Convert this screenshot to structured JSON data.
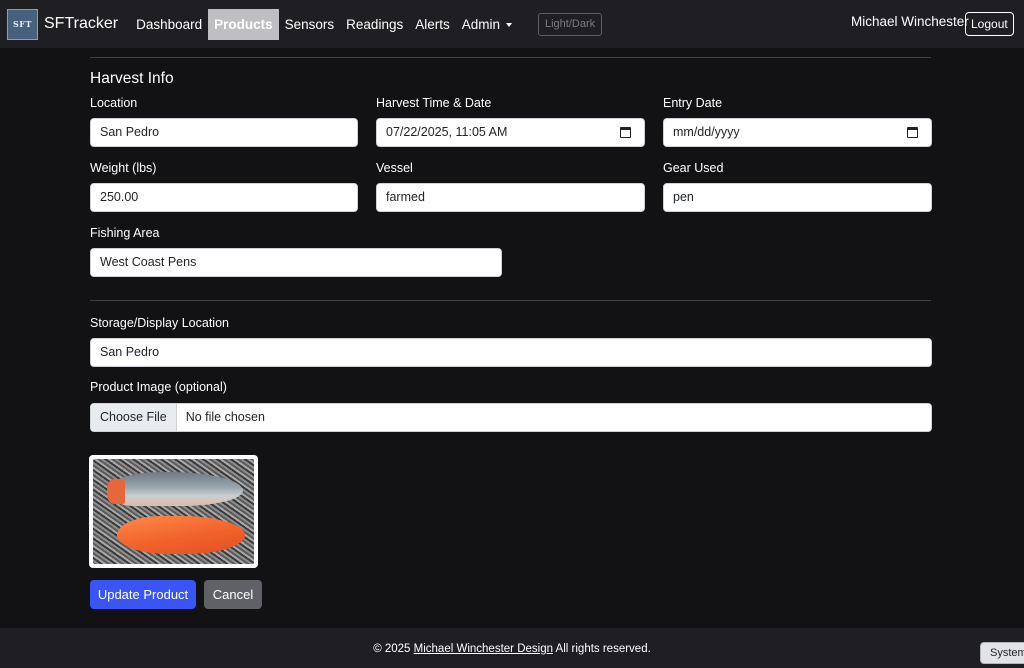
{
  "nav": {
    "logo_text": "SFT",
    "brand": "SFTracker",
    "links": [
      "Dashboard",
      "Products",
      "Sensors",
      "Readings",
      "Alerts",
      "Admin"
    ],
    "active": "Products",
    "theme_toggle": "Light/Dark",
    "user": "Michael Winchester",
    "logout": "Logout"
  },
  "harvest": {
    "title": "Harvest Info",
    "location": {
      "label": "Location",
      "value": "San Pedro"
    },
    "harvest_time": {
      "label": "Harvest Time & Date",
      "value": "07/22/2025, 11:05  AM"
    },
    "entry_date": {
      "label": "Entry Date",
      "value": "mm/dd/yyyy"
    },
    "weight": {
      "label": "Weight (lbs)",
      "value": "250.00"
    },
    "vessel": {
      "label": "Vessel",
      "value": "farmed"
    },
    "gear": {
      "label": "Gear Used",
      "value": "pen"
    },
    "fishing_area": {
      "label": "Fishing Area",
      "value": "West Coast Pens"
    }
  },
  "storage": {
    "label": "Storage/Display Location",
    "value": "San Pedro"
  },
  "image": {
    "label": "Product Image (optional)",
    "choose_button": "Choose File",
    "status": "No file chosen",
    "preview_icon": "salmon-fillet-photo"
  },
  "actions": {
    "update": "Update Product",
    "cancel": "Cancel"
  },
  "footer": {
    "prefix": "© 2025 ",
    "link": "Michael Winchester Design",
    "suffix": " All rights reserved.",
    "system_button": "System"
  },
  "colors": {
    "primary": "#3a55f5",
    "secondary": "#5f6166",
    "navbar": "#1f1f23",
    "background": "#121214"
  }
}
